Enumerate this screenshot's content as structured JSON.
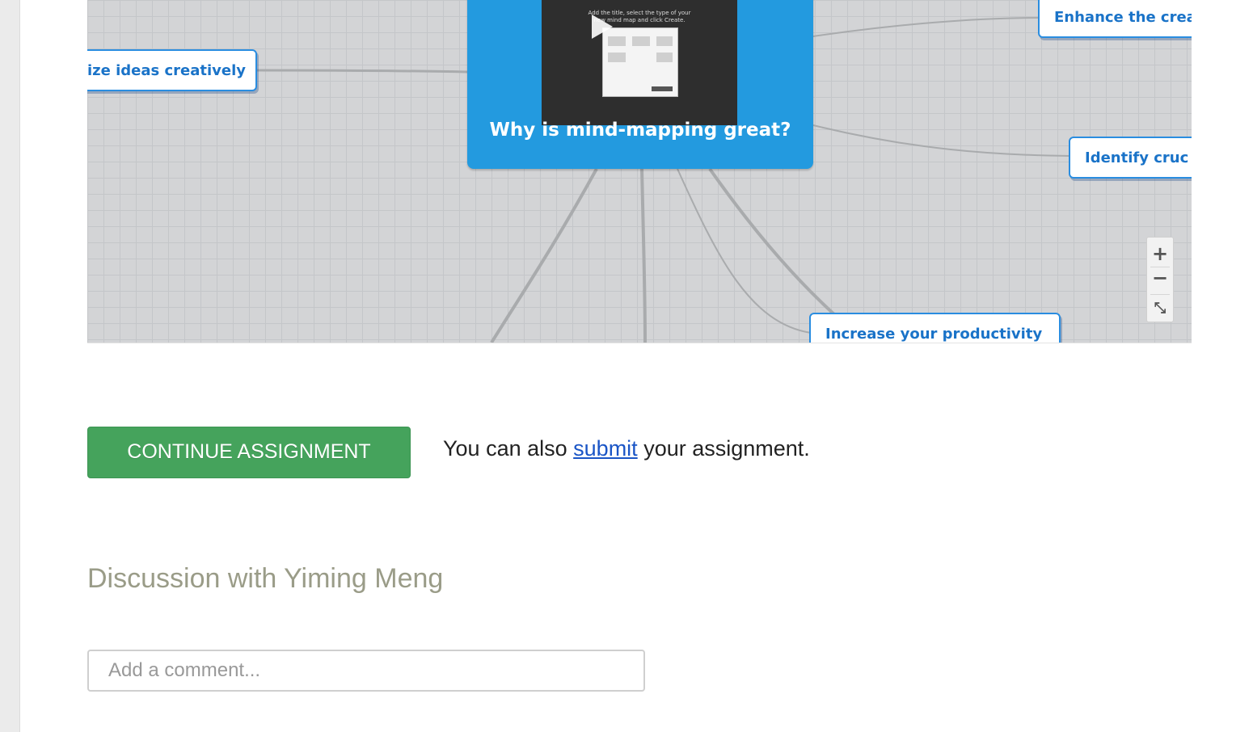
{
  "mindmap": {
    "central_title": "Why is mind-mapping great?",
    "video_caption_line1": "Add the title, select the type of your",
    "video_caption_line2": "new mind map and click Create.",
    "nodes": {
      "organize": "ize ideas creatively",
      "enhance": "Enhance the crea",
      "identify": "Identify cruc",
      "productivity": "Increase your productivity"
    },
    "zoom": {
      "in_label": "+",
      "out_label": "−",
      "fit_label": "⤡"
    }
  },
  "assignment": {
    "continue_label": "CONTINUE ASSIGNMENT",
    "also_text": "You can also",
    "submit_link": "submit",
    "after_text": "your assignment."
  },
  "discussion": {
    "title": "Discussion with Yiming Meng",
    "comment_placeholder": "Add a comment..."
  },
  "colors": {
    "node_border": "#2a8de0",
    "central_bg": "#239adf",
    "continue_bg": "#45a35c",
    "link": "#1a55c6"
  }
}
